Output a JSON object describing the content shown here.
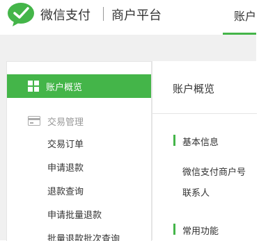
{
  "header": {
    "brand_name": "微信支付",
    "brand_sub": "商户平台",
    "nav": [
      {
        "label": "账户"
      }
    ]
  },
  "sidebar": {
    "active_item": {
      "label": "账户概览",
      "icon": "grid-icon"
    },
    "groups": [
      {
        "label": "交易管理",
        "icon": "card-icon",
        "items": [
          {
            "label": "交易订单"
          },
          {
            "label": "申请退款"
          },
          {
            "label": "退款查询"
          },
          {
            "label": "申请批量退款"
          },
          {
            "label": "批量退款批次查询"
          }
        ]
      }
    ]
  },
  "main": {
    "title": "账户概览",
    "sections": [
      {
        "title": "基本信息",
        "fields": [
          "微信支付商户号",
          "联系人"
        ]
      },
      {
        "title": "常用功能"
      }
    ]
  },
  "colors": {
    "accent": "#44b549",
    "background": "#f0f0f0"
  }
}
